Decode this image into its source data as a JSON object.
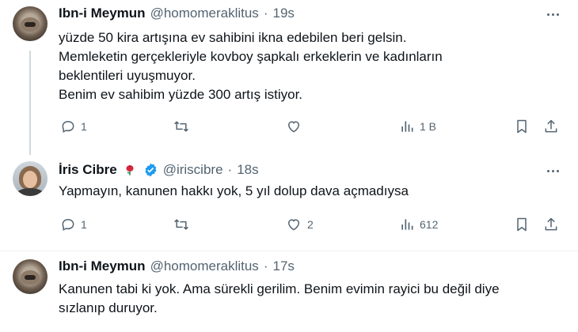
{
  "colors": {
    "text": "#0f1419",
    "secondary": "#536471",
    "thread": "#cfd9de",
    "verified": "#1d9bf0",
    "divider": "#eff3f4"
  },
  "tweets": [
    {
      "name": "Ibn-i Meymun",
      "handle": "@homomeraklitus",
      "dot": "·",
      "time": "19s",
      "avatar_icon": "monkey-avatar",
      "lines": [
        "yüzde 50 kira artışına ev sahibini ikna edebilen beri gelsin.",
        "Memleketin gerçekleriyle kovboy şapkalı erkeklerin ve kadınların",
        "beklentileri uyuşmuyor.",
        "Benim ev sahibim yüzde 300 artış istiyor."
      ],
      "replies": "1",
      "retweets": "",
      "likes": "",
      "views": "1 B"
    },
    {
      "name": "İris Cibre",
      "badge": "rose-emoji",
      "handle": "@iriscibre",
      "dot": "·",
      "time": "18s",
      "avatar_icon": "woman-avatar",
      "lines": [
        "Yapmayın, kanunen hakkı yok, 5 yıl dolup dava açmadıysa"
      ],
      "replies": "1",
      "retweets": "",
      "likes": "2",
      "views": "612"
    },
    {
      "name": "Ibn-i Meymun",
      "handle": "@homomeraklitus",
      "dot": "·",
      "time": "17s",
      "avatar_icon": "monkey-avatar",
      "lines": [
        "Kanunen tabi ki yok. Ama sürekli gerilim. Benim evimin rayici bu değil diye",
        "sızlanıp duruyor."
      ]
    }
  ]
}
